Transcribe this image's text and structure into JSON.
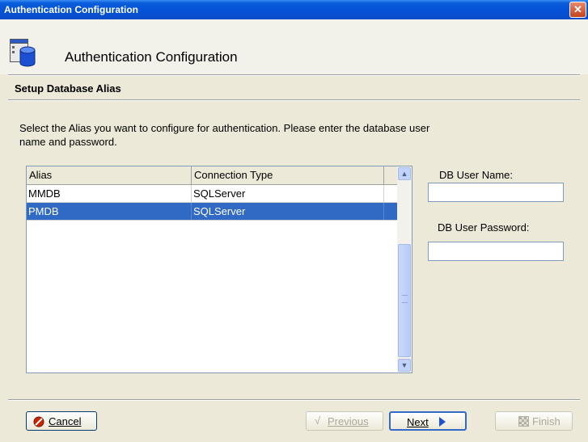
{
  "window": {
    "title": "Authentication Configuration",
    "close_symbol": "✕"
  },
  "header": {
    "title": "Authentication Configuration",
    "icon": "database-config-icon"
  },
  "step": {
    "title": "Setup Database Alias",
    "description": "Select the Alias you want to configure for authentication. Please enter the database user name and password."
  },
  "alias_list": {
    "columns": [
      "Alias",
      "Connection Type"
    ],
    "rows": [
      {
        "alias": "MMDB",
        "type": "SQLServer",
        "selected": false
      },
      {
        "alias": "PMDB",
        "type": "SQLServer",
        "selected": true
      }
    ]
  },
  "fields": {
    "db_user_name_label": "DB User Name:",
    "db_user_name_value": "",
    "db_user_password_label": "DB User Password:",
    "db_user_password_value": ""
  },
  "buttons": {
    "cancel": "Cancel",
    "previous": "Previous",
    "next": "Next",
    "finish": "Finish"
  },
  "colors": {
    "selection": "#316ac5",
    "titlebar": "#0551d6",
    "cancel_icon": "#cc2200"
  }
}
